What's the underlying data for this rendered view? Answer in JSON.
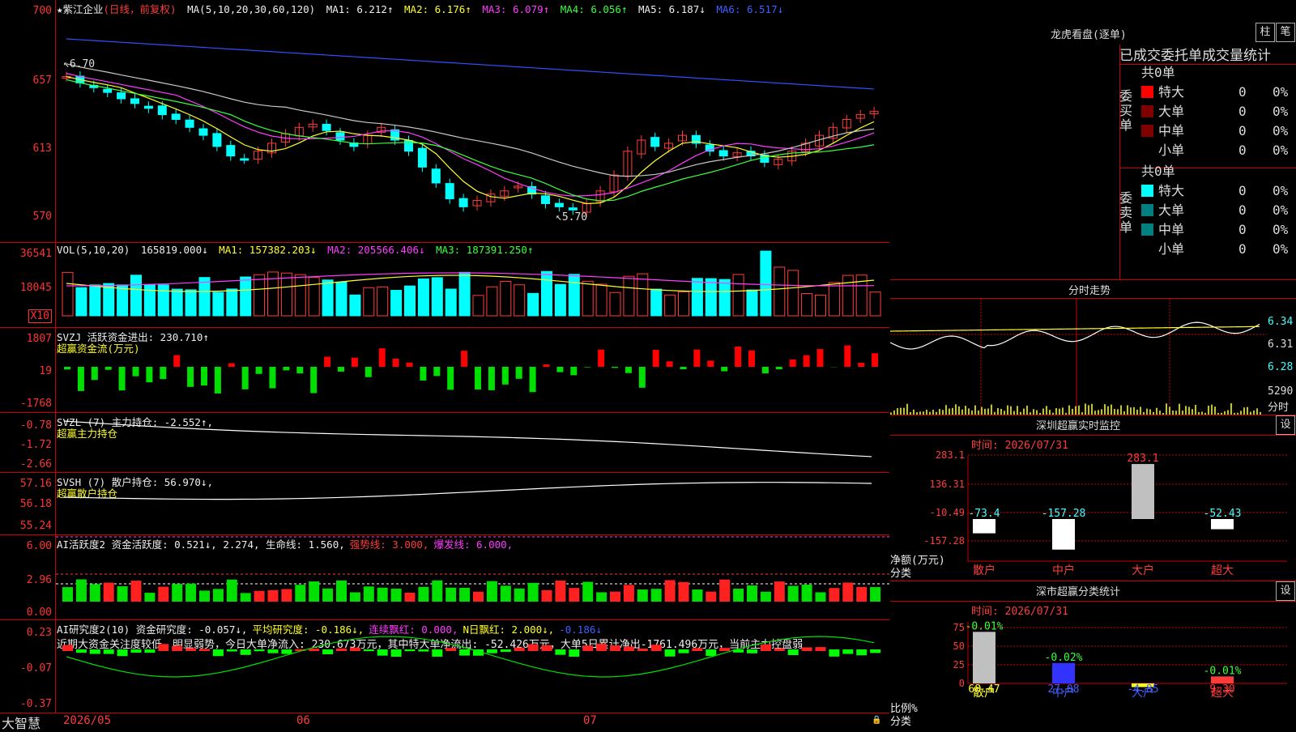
{
  "stock": {
    "name": "★紫江企业",
    "mode": "(日线，前复权)"
  },
  "ma": {
    "label": "MA(5,10,20,30,60,120)",
    "items": [
      {
        "t": "MA1: 6.212↑",
        "c": "#eeeeee"
      },
      {
        "t": "MA2: 6.176↑",
        "c": "#ffff28"
      },
      {
        "t": "MA3: 6.079↑",
        "c": "#ff3cff"
      },
      {
        "t": "MA4: 6.056↑",
        "c": "#3cff3c"
      },
      {
        "t": "MA5: 6.187↓",
        "c": "#eeeeee"
      },
      {
        "t": "MA6: 6.517↓",
        "c": "#4060ff"
      }
    ]
  },
  "price_axis": [
    "700",
    "657",
    "613",
    "570"
  ],
  "price_marks": {
    "high": "6.70",
    "low": "5.70"
  },
  "vol": {
    "label": "VOL(5,10,20)",
    "value": "165819.000↓",
    "ma1": "MA1: 157382.203↓",
    "ma2": "MA2: 205566.406↓",
    "ma3": "MA3: 187391.250↑",
    "axis": [
      "36541",
      "18045"
    ],
    "unit": "X10"
  },
  "svzj": {
    "label": "SVZJ  活跃资金进出: 230.710↑",
    "sub": "超赢资金流(万元)",
    "axis": [
      "1807",
      "19",
      "-1768"
    ]
  },
  "svzl": {
    "label": "SVZL (7) 主力持仓: -2.552↑,",
    "sub": "超赢主力持仓",
    "axis": [
      "-0.78",
      "-1.72",
      "-2.66"
    ]
  },
  "svsh": {
    "label": "SVSH (7) 散户持仓: 56.970↓,",
    "sub": "超赢散户持仓",
    "axis": [
      "57.16",
      "56.18",
      "55.24"
    ]
  },
  "ai1": {
    "label": "AI活跃度2 资金活跃度: 0.521↓, 2.274, 生命线: 1.560,",
    "strong": "强势线: 3.000,",
    "burst": "爆发线: 6.000,",
    "axis": [
      "6.00",
      "2.96",
      "0.00"
    ]
  },
  "ai2": {
    "label": "AI研究度2(10) 资金研究度: -0.057↓,",
    "avg": "平均研究度: -0.186↓,",
    "red": "连续飘红: 0.000,",
    "nred": "N日飘红: 2.000↓,",
    "last": "-0.186↓",
    "comment": "近期大资金关注度较低，明显弱势，今日大单净流入: 230.673万元，其中特大单净流出: -52.426万元，大单5日累计净出-1761.496万元，当前主力控盘弱",
    "axis": [
      "0.23",
      "-0.07",
      "-0.37"
    ]
  },
  "bottom": {
    "brand": "大智慧",
    "x_labels": [
      "2026/05",
      "06",
      "07"
    ]
  },
  "lhb": {
    "title": "龙虎看盘(逐单)",
    "btn1": "柱",
    "btn2": "笔",
    "subtitle": "已成交委托单成交量统计",
    "buy": {
      "label": "委买单",
      "total": "共0单",
      "rows": [
        {
          "n": "特大",
          "v": "0",
          "p": "0%",
          "c": "#ff0000"
        },
        {
          "n": "大单",
          "v": "0",
          "p": "0%",
          "c": "#800000"
        },
        {
          "n": "中单",
          "v": "0",
          "p": "0%",
          "c": "#800000"
        },
        {
          "n": "小单",
          "v": "0",
          "p": "0%",
          "c": "#000000"
        }
      ]
    },
    "sell": {
      "label": "委卖单",
      "total": "共0单",
      "rows": [
        {
          "n": "特大",
          "v": "0",
          "p": "0%",
          "c": "#00ffff"
        },
        {
          "n": "大单",
          "v": "0",
          "p": "0%",
          "c": "#008080"
        },
        {
          "n": "中单",
          "v": "0",
          "p": "0%",
          "c": "#008080"
        },
        {
          "n": "小单",
          "v": "0",
          "p": "0%",
          "c": "#000000"
        }
      ]
    }
  },
  "fenshi": {
    "title": "分时走势",
    "axis": [
      "6.34",
      "6.31",
      "6.28"
    ],
    "vol": "5290",
    "vol_lbl": "分时"
  },
  "sz1": {
    "title": "深圳超赢实时监控",
    "btn": "设",
    "time": "时间: 2026/07/31",
    "axis": [
      "283.1",
      "136.31",
      "-10.49",
      "-157.28"
    ],
    "ylab": "净额(万元)",
    "xlab": "分类",
    "cats": [
      "散户",
      "中户",
      "大户",
      "超大"
    ],
    "values": [
      -73.4,
      -157.28,
      283.1,
      -52.43
    ],
    "labels": [
      "-73.4",
      "-157.28",
      "283.1",
      "-52.43"
    ]
  },
  "sz2": {
    "title": "深市超赢分类统计",
    "btn": "设",
    "time": "时间: 2026/07/31",
    "axis": [
      "75",
      "50",
      "25",
      "0"
    ],
    "ylab": "比例%",
    "xlab": "分类",
    "cats": [
      "散户",
      "中户",
      "大户",
      "超大"
    ],
    "values": [
      68.47,
      27.08,
      -4.85,
      9.3
    ],
    "labels": [
      "68.47",
      "27.08",
      "-4.85",
      "9.30"
    ],
    "top": [
      "-0.01%",
      "-0.02%",
      "",
      "-0.01%"
    ]
  },
  "colors": {
    "up": "#ff3c3c",
    "down": "#00ffff",
    "grid": "#c00000"
  }
}
